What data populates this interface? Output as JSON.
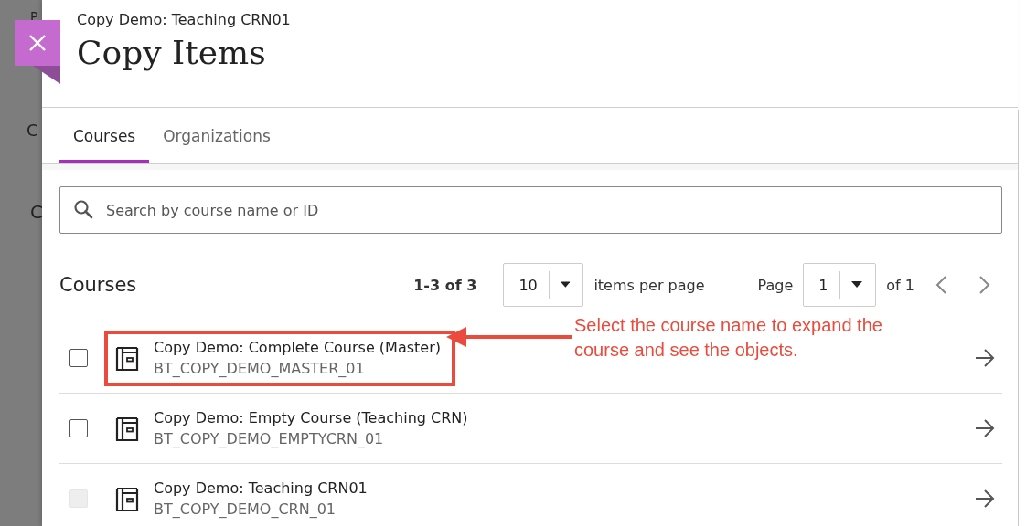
{
  "background": {
    "texts": [
      "P",
      "C",
      "C"
    ]
  },
  "panel": {
    "subtitle": "Copy Demo: Teaching CRN01",
    "title": "Copy Items"
  },
  "tabs": [
    {
      "label": "Courses",
      "selected": true
    },
    {
      "label": "Organizations",
      "selected": false
    }
  ],
  "search": {
    "placeholder": "Search by course name or ID"
  },
  "list": {
    "heading": "Courses",
    "range": "1-3 of 3",
    "per_page": "10",
    "per_page_label": "items per page",
    "page_label": "Page",
    "page": "1",
    "page_total": "of 1"
  },
  "courses": [
    {
      "name": "Copy Demo: Complete Course (Master)",
      "id": "BT_COPY_DEMO_MASTER_01",
      "checked": false,
      "disabled": false,
      "highlighted": true
    },
    {
      "name": "Copy Demo: Empty Course (Teaching CRN)",
      "id": "BT_COPY_DEMO_EMPTYCRN_01",
      "checked": false,
      "disabled": false,
      "highlighted": false
    },
    {
      "name": "Copy Demo: Teaching CRN01",
      "id": "BT_COPY_DEMO_CRN_01",
      "checked": false,
      "disabled": true,
      "highlighted": false
    }
  ],
  "annotation": {
    "text": "Select the course name to expand the course and see the objects."
  }
}
